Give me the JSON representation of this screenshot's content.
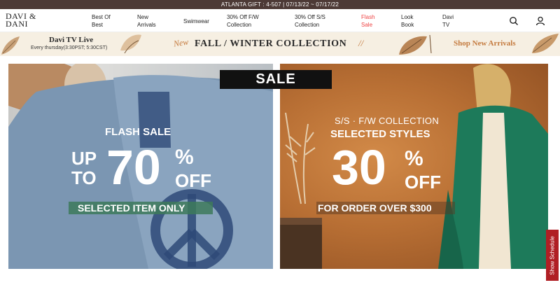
{
  "top_bar": {
    "text": "ATLANTA GIFT : 4-507 | 07/13/22 ~ 07/17/22"
  },
  "header": {
    "logo_line1": "DAVI &",
    "logo_line2": "DANI",
    "nav": [
      {
        "label": "Best Of Best"
      },
      {
        "label": "New Arrivals"
      },
      {
        "label": "Swimwear"
      },
      {
        "label": "30% Off F/W Collection"
      },
      {
        "label": "30% Off S/S Collection"
      },
      {
        "label": "Flash Sale"
      },
      {
        "label": "Look Book"
      },
      {
        "label": "Davi TV"
      }
    ],
    "icons": [
      "search-icon",
      "user-icon"
    ]
  },
  "banner": {
    "tv_title": "Davi TV Live",
    "tv_sub": "Every thursday(3:30PST; 5:30CST)",
    "new": "New",
    "collection": "FALL / WINTER COLLECTION",
    "slash": "//",
    "shop": "Shop New Arrivals"
  },
  "sale_label": "SALE",
  "left_panel": {
    "title": "FLASH SALE",
    "up": "UP",
    "to": "TO",
    "big": "70",
    "pct": "%",
    "off": "OFF",
    "sub": "SELECTED ITEM ONLY"
  },
  "right_panel": {
    "line1": "S/S · F/W COLLECTION",
    "line2": "SELECTED STYLES",
    "big": "30",
    "pct": "%",
    "off": "OFF",
    "sub": "FOR ORDER OVER $300"
  },
  "show_schedule": "Show Schedule",
  "colors": {
    "topbar": "#4d3a36",
    "accent": "#c47a3e",
    "flash": "#e44444",
    "green": "#3d7a5a",
    "red_tab": "#b01f24"
  }
}
